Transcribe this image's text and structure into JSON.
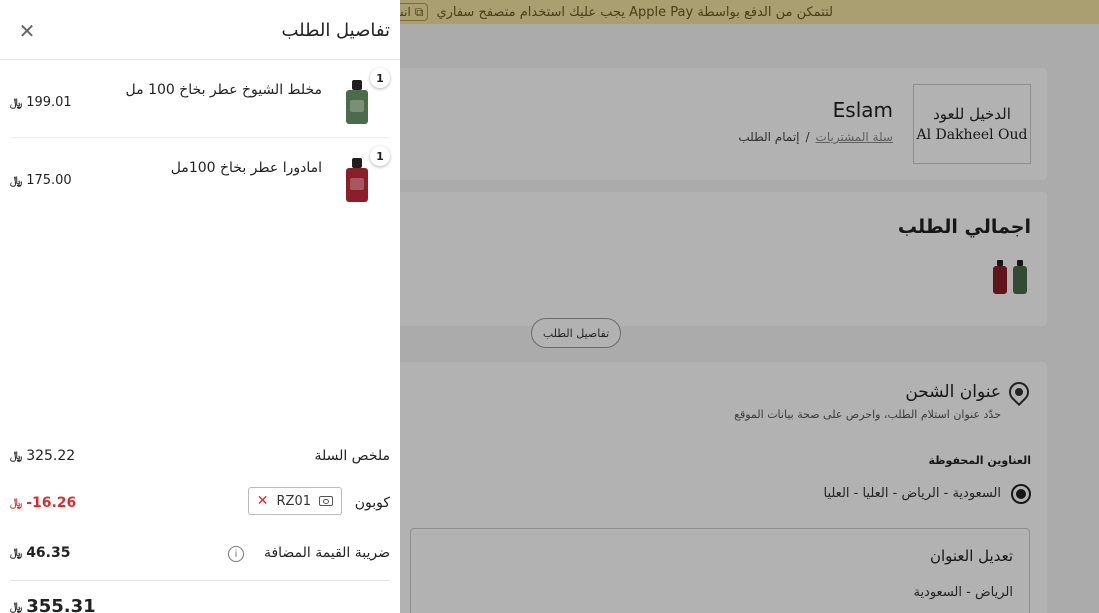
{
  "banner": {
    "text": "لتتمكن من الدفع بواسطة Apple Pay يجب عليك استخدام متصفح سفاري",
    "copy_label": "انسخ"
  },
  "store": {
    "logo_ar": "الدخيل للعود",
    "logo_en": "Al Dakheel Oud",
    "name": "Eslam",
    "breadcrumb": [
      "سلة المشتريات",
      "إتمام الطلب"
    ],
    "breadcrumb_sep": "/"
  },
  "summary": {
    "title": "اجمالي الطلب",
    "details_button": "تفاصيل الطلب"
  },
  "address": {
    "title": "عنوان الشحن",
    "subtitle": "حدّد عنوان استلام الطلب، واحرص على صحة بيانات الموقع",
    "saved_label": "العناوين المحفوظة",
    "saved_option": "السعودية - الرياض - العليا - العليا",
    "edit_title": "تعديل العنوان",
    "edit_line": "الرياض - السعودية"
  },
  "drawer": {
    "title": "تفاصيل الطلب",
    "items": [
      {
        "name": "مخلط الشيوخ عطر بخاخ 100 مل",
        "qty": "1",
        "price": "199.01",
        "color": "#4c6b4a"
      },
      {
        "name": "امادورا عطر بخاخ 100مل",
        "qty": "1",
        "price": "175.00",
        "color": "#8a1f2a"
      }
    ],
    "currency": "﷼",
    "basket_label": "ملخص السلة",
    "basket_value": "325.22",
    "coupon_label": "كوبون",
    "coupon_code": "RZ01",
    "coupon_value": "-16.26",
    "vat_label": "ضريبة القيمة المضافة",
    "vat_value": "46.35",
    "total_value": "355.31"
  }
}
